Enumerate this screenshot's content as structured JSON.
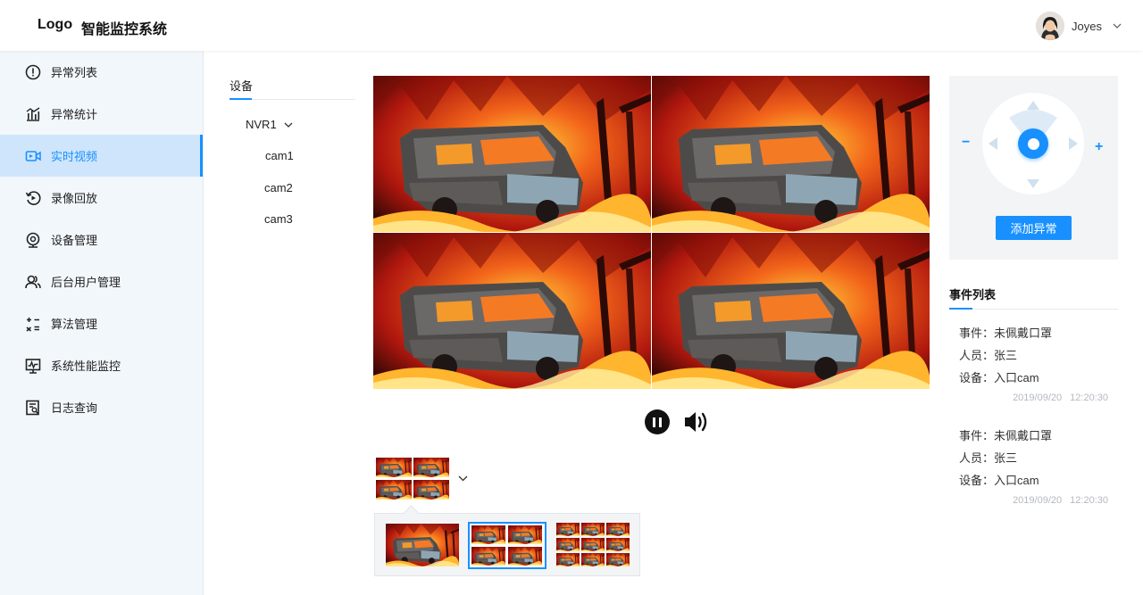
{
  "header": {
    "logo": "Logo",
    "title": "智能监控系统",
    "user_name": "Joyes"
  },
  "sidebar": {
    "items": [
      {
        "label": "异常列表",
        "icon": "alert-circle-icon"
      },
      {
        "label": "异常统计",
        "icon": "bar-stats-icon"
      },
      {
        "label": "实时视频",
        "icon": "video-camera-icon",
        "active": true
      },
      {
        "label": "录像回放",
        "icon": "replay-icon"
      },
      {
        "label": "设备管理",
        "icon": "webcam-icon"
      },
      {
        "label": "后台用户管理",
        "icon": "users-icon"
      },
      {
        "label": "算法管理",
        "icon": "calculator-icon"
      },
      {
        "label": "系统性能监控",
        "icon": "monitor-chart-icon"
      },
      {
        "label": "日志查询",
        "icon": "log-search-icon"
      }
    ]
  },
  "device_tree": {
    "tab": "设备",
    "nvr": "NVR1",
    "cams": [
      "cam1",
      "cam2",
      "cam3"
    ]
  },
  "video": {
    "layout": "2x2",
    "layout_options": [
      "1x1",
      "2x2",
      "3x3"
    ],
    "selected_layout_index": 1
  },
  "ptz": {
    "zoom_out": "−",
    "zoom_in": "+",
    "add_button": "添加异常"
  },
  "events": {
    "title": "事件列表",
    "items": [
      {
        "event_label": "事件：",
        "event": "未佩戴口罩",
        "person_label": "人员：",
        "person": "张三",
        "device_label": "设备：",
        "device": "入口cam",
        "time": "2019/09/20 12:20:30"
      },
      {
        "event_label": "事件：",
        "event": "未佩戴口罩",
        "person_label": "人员：",
        "person": "张三",
        "device_label": "设备：",
        "device": "入口cam",
        "time": "2019/09/20 12:20:30"
      }
    ]
  },
  "colors": {
    "accent": "#1890ff",
    "sidebar_bg": "#f2f7fc",
    "active_bg": "#cfe5fb"
  }
}
